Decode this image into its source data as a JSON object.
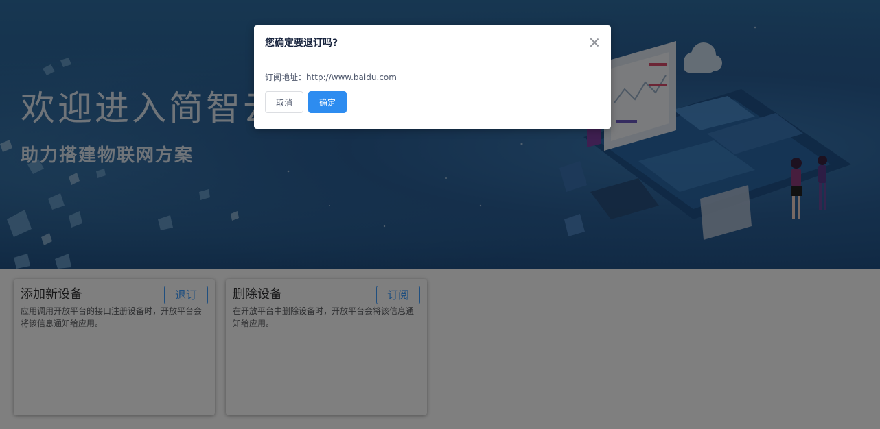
{
  "banner": {
    "title": "欢迎进入简智云",
    "subtitle": "助力搭建物联网方案"
  },
  "cards": [
    {
      "title": "添加新设备",
      "button_label": "退订",
      "description": "应用调用开放平台的接口注册设备时，开放平台会将该信息通知给应用。"
    },
    {
      "title": "删除设备",
      "button_label": "订阅",
      "description": "在开放平台中删除设备时，开放平台会将该信息通知给应用。"
    }
  ],
  "dialog": {
    "title": "您确定要退订吗?",
    "body_text": "订阅地址：http://www.baidu.com",
    "cancel_label": "取消",
    "confirm_label": "确定",
    "close_icon": "close-icon"
  },
  "colors": {
    "primary": "#2d8cf0",
    "accent_outline": "#409eff",
    "banner_bg": "#265d93",
    "overlay": "rgba(0,0,0,0.5)"
  }
}
